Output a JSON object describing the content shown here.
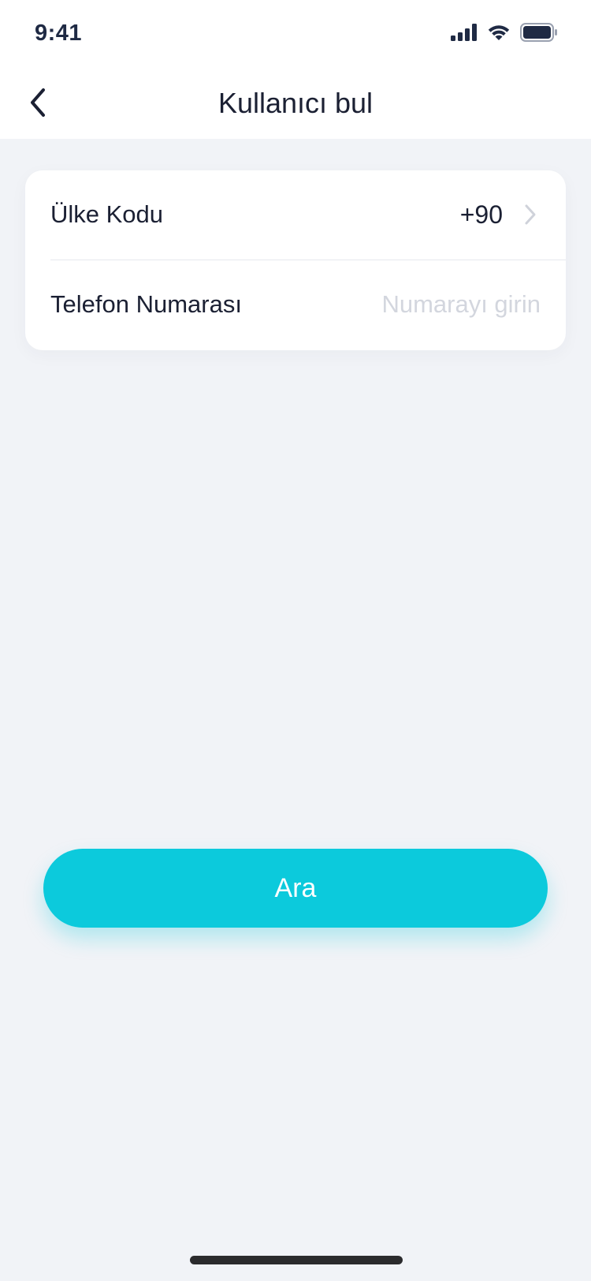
{
  "status_bar": {
    "time": "9:41",
    "icons": [
      "cellular-signal-icon",
      "wifi-icon",
      "battery-icon"
    ]
  },
  "nav": {
    "back_icon": "chevron-left-icon",
    "title": "Kullanıcı bul"
  },
  "form": {
    "country_code": {
      "label": "Ülke Kodu",
      "value": "+90",
      "icon": "chevron-right-icon"
    },
    "phone": {
      "label": "Telefon Numarası",
      "value": "",
      "placeholder": "Numarayı girin"
    }
  },
  "search_button": {
    "label": "Ara"
  },
  "colors": {
    "accent": "#0ccadc",
    "background": "#f1f3f7",
    "text_primary": "#1b2033",
    "placeholder": "#d3d6de"
  }
}
